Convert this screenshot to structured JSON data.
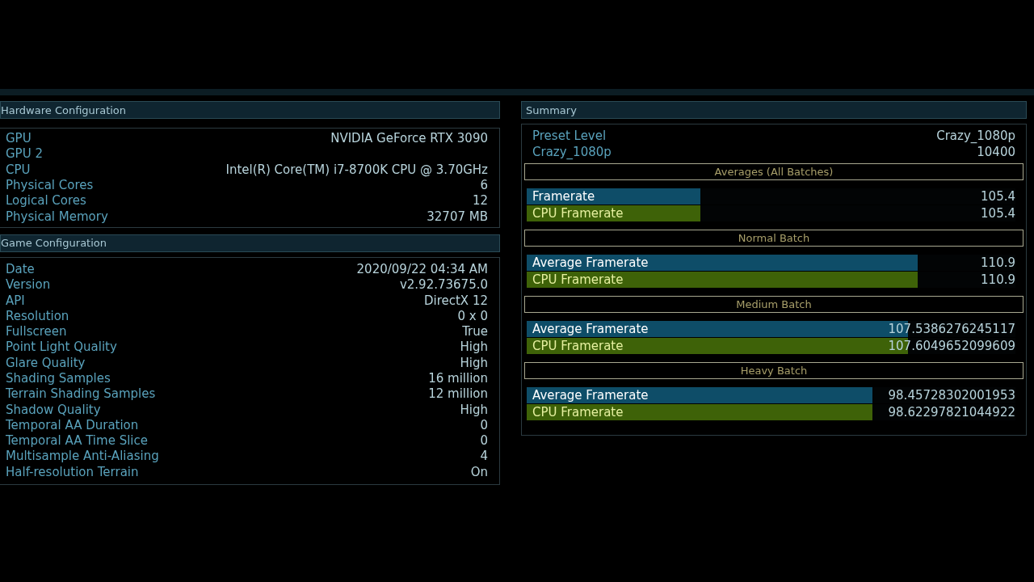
{
  "hardware": {
    "title": "Hardware Configuration",
    "rows": [
      {
        "label": "GPU",
        "value": "NVIDIA GeForce RTX 3090"
      },
      {
        "label": "GPU 2"
      },
      {
        "label": "CPU",
        "value": "Intel(R) Core(TM) i7-8700K CPU @ 3.70GHz"
      },
      {
        "label": "Physical Cores",
        "value": "6"
      },
      {
        "label": "Logical Cores",
        "value": "12"
      },
      {
        "label": "Physical Memory",
        "value": "32707 MB"
      }
    ]
  },
  "game": {
    "title": "Game Configuration",
    "rows": [
      {
        "label": "Date",
        "value": "2020/09/22 04:34 AM"
      },
      {
        "label": "Version",
        "value": "v2.92.73675.0"
      },
      {
        "label": "API",
        "value": "DirectX 12"
      },
      {
        "label": "Resolution",
        "value": "0 x 0"
      },
      {
        "label": "Fullscreen",
        "value": "True"
      },
      {
        "label": "Point Light Quality",
        "value": "High"
      },
      {
        "label": "Glare Quality",
        "value": "High"
      },
      {
        "label": "Shading Samples",
        "value": "16 million"
      },
      {
        "label": "Terrain Shading Samples",
        "value": "12 million"
      },
      {
        "label": "Shadow Quality",
        "value": "High"
      },
      {
        "label": "Temporal AA Duration",
        "value": "0"
      },
      {
        "label": "Temporal AA Time Slice",
        "value": "0"
      },
      {
        "label": "Multisample Anti-Aliasing",
        "value": "4"
      },
      {
        "label": "Half-resolution Terrain",
        "value": "On"
      }
    ]
  },
  "summary": {
    "title": "Summary",
    "rows": [
      {
        "label": "Preset Level",
        "value": "Crazy_1080p"
      },
      {
        "label": "Crazy_1080p",
        "value": "10400"
      }
    ],
    "batches": [
      {
        "title": "Averages (All Batches)",
        "bars": [
          {
            "kind": "gpu",
            "label": "Framerate",
            "value": "105.4",
            "level": 0.355
          },
          {
            "kind": "cpu",
            "label": "CPU Framerate",
            "value": "105.4",
            "level": 0.355
          }
        ]
      },
      {
        "title": "Normal Batch",
        "bars": [
          {
            "kind": "gpu",
            "label": "Average Framerate",
            "value": "110.9",
            "level": 0.8
          },
          {
            "kind": "cpu",
            "label": "CPU Framerate",
            "value": "110.9",
            "level": 0.8
          }
        ]
      },
      {
        "title": "Medium Batch",
        "bars": [
          {
            "kind": "gpu",
            "label": "Average Framerate",
            "value": "107.5386276245117",
            "level": 0.78
          },
          {
            "kind": "cpu",
            "label": "CPU Framerate",
            "value": "107.6049652099609",
            "level": 0.78
          }
        ]
      },
      {
        "title": "Heavy Batch",
        "bars": [
          {
            "kind": "gpu",
            "label": "Average Framerate",
            "value": "98.45728302001953",
            "level": 0.708
          },
          {
            "kind": "cpu",
            "label": "CPU Framerate",
            "value": "98.62297821044922",
            "level": 0.708
          }
        ]
      }
    ]
  }
}
